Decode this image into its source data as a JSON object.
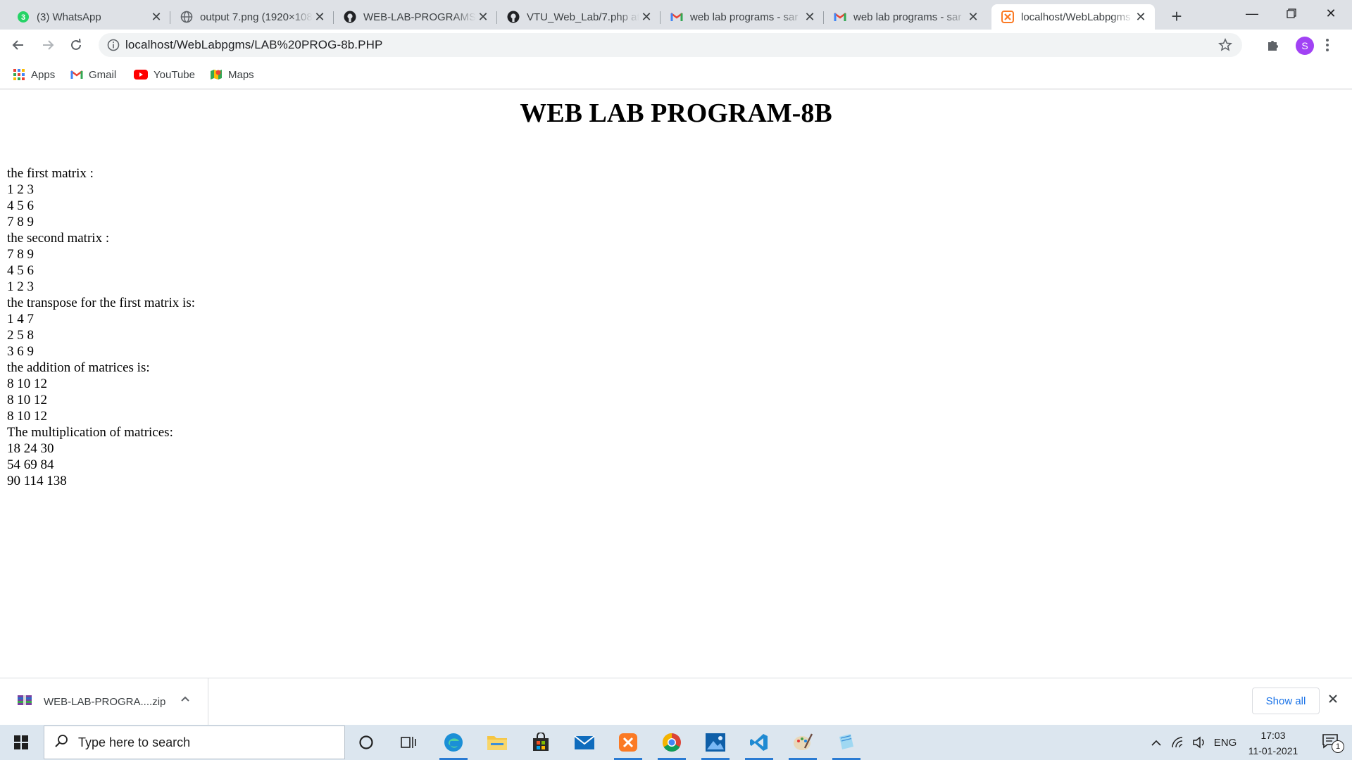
{
  "tabs": [
    {
      "title": "(3) WhatsApp",
      "badge": "3",
      "icon": "whatsapp-icon"
    },
    {
      "title": "output 7.png (1920×1080)",
      "icon": "globe-icon"
    },
    {
      "title": "WEB-LAB-PROGRAMS/",
      "icon": "github-icon"
    },
    {
      "title": "VTU_Web_Lab/7.php at",
      "icon": "github-icon"
    },
    {
      "title": "web lab programs - sar",
      "icon": "gmail-icon"
    },
    {
      "title": "web lab programs - sar",
      "icon": "gmail-icon"
    },
    {
      "title": "localhost/WebLabpgms",
      "icon": "xampp-icon",
      "active": true
    }
  ],
  "address": {
    "url": "localhost/WebLabpgms/LAB%20PROG-8b.PHP"
  },
  "profile": {
    "initial": "S",
    "color": "#a142f4"
  },
  "bookmarks": [
    {
      "label": "Apps",
      "icon": "apps-grid-icon"
    },
    {
      "label": "Gmail",
      "icon": "gmail-icon"
    },
    {
      "label": "YouTube",
      "icon": "youtube-icon"
    },
    {
      "label": "Maps",
      "icon": "maps-icon"
    }
  ],
  "page": {
    "heading": "WEB LAB PROGRAM-8B",
    "lines": [
      "the first matrix :",
      "1 2 3",
      "4 5 6",
      "7 8 9",
      "the second matrix :",
      "7 8 9",
      "4 5 6",
      "1 2 3",
      "the transpose for the first matrix is:",
      "1 4 7",
      "2 5 8",
      "3 6 9",
      "the addition of matrices is:",
      "8 10 12",
      "8 10 12",
      "8 10 12",
      "The multiplication of matrices:",
      "18 24 30",
      "54 69 84",
      "90 114 138"
    ]
  },
  "download": {
    "filename": "WEB-LAB-PROGRA....zip",
    "show_all": "Show all"
  },
  "taskbar": {
    "search_placeholder": "Type here to search",
    "language": "ENG",
    "time": "17:03",
    "date": "11-01-2021",
    "notifications": "1"
  },
  "colors": {
    "accent": "#1a73e8",
    "taskbar": "#dce6ef",
    "tabstrip": "#dee1e6"
  }
}
